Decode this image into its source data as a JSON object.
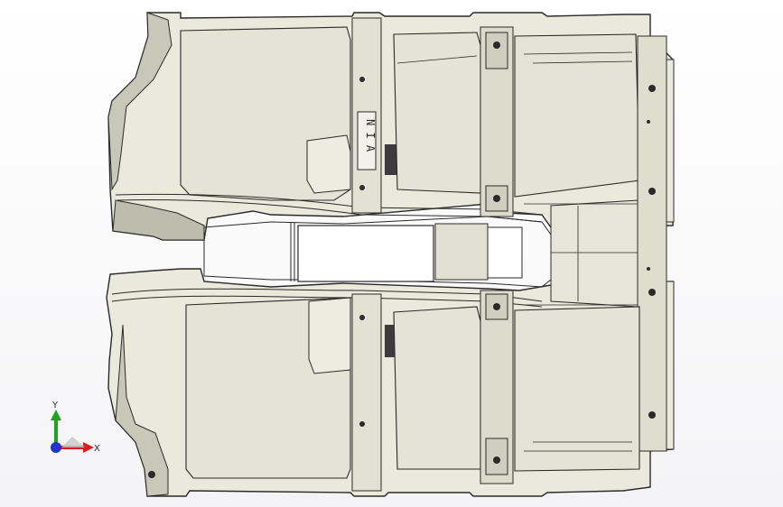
{
  "viewport": {
    "background": "#ffffff",
    "model_fill": "#e9e9dc",
    "model_fill_dark": "#c8c8b8",
    "model_shadow": "#8e8e86",
    "edge_color": "#2a2a2a",
    "part_marking": "N I A"
  },
  "triad": {
    "x_label": "X",
    "y_label": "Y",
    "x_color": "#d42020",
    "y_color": "#1fa31f",
    "z_color": "#2233cc"
  }
}
